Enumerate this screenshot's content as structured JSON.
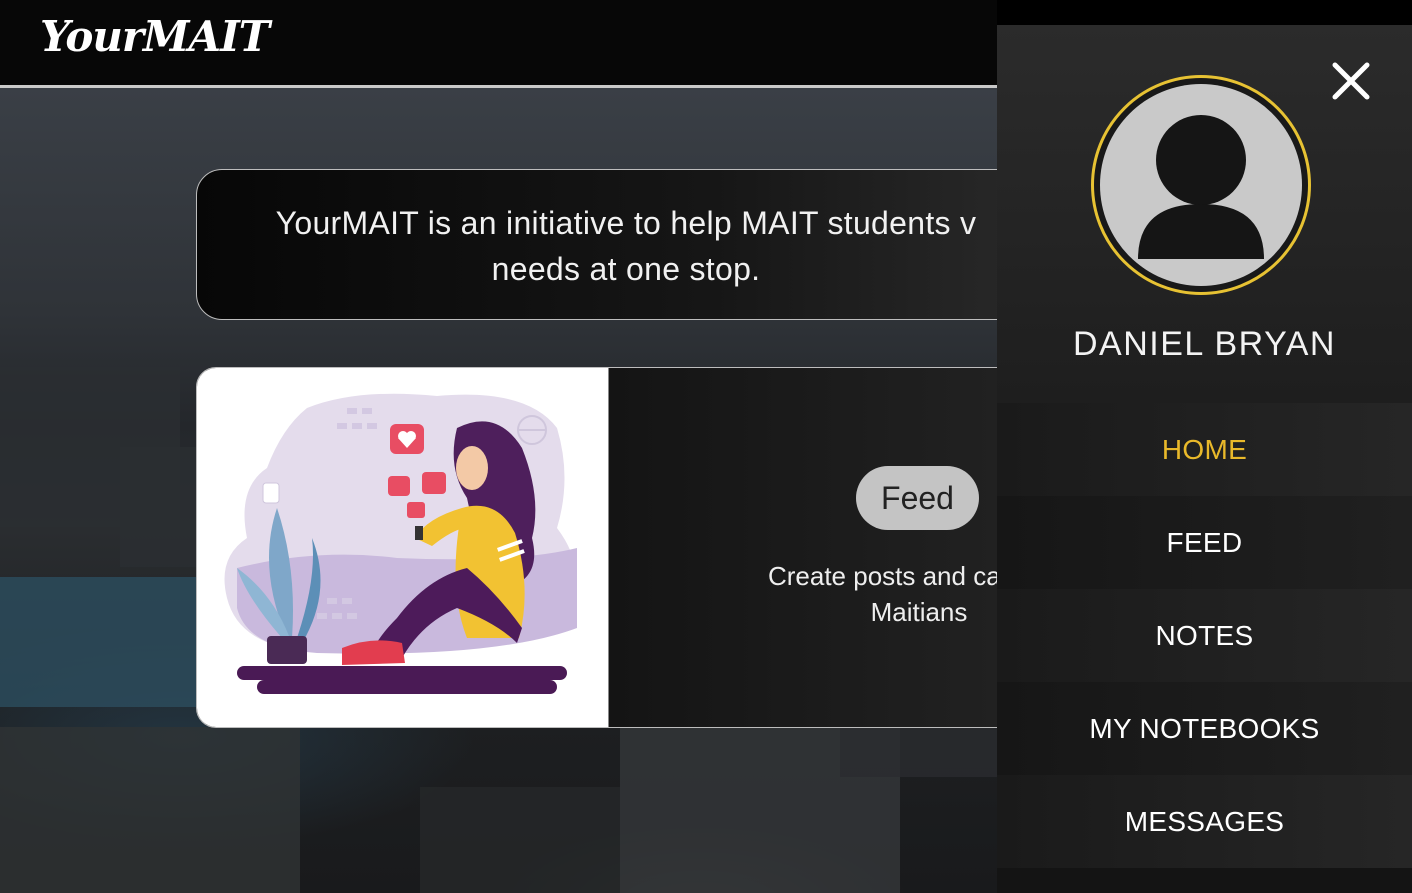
{
  "app": {
    "logo": "YourMAIT"
  },
  "intro": {
    "text_line1": "YourMAIT is an initiative to help MAIT students v",
    "text_line2": "needs at one stop."
  },
  "feature_card": {
    "button_label": "Feed",
    "description_line1": "Create posts and catch lat",
    "description_line2": "Maitians",
    "illustration": "girl-with-phone-illustration"
  },
  "drawer": {
    "user_name": "DANIEL BRYAN",
    "close_icon": "close-icon",
    "avatar_icon": "user-avatar-icon",
    "accent_color": "#e7c233",
    "nav": [
      {
        "label": "HOME",
        "active": true
      },
      {
        "label": "FEED",
        "active": false
      },
      {
        "label": "NOTES",
        "active": false
      },
      {
        "label": "MY NOTEBOOKS",
        "active": false
      },
      {
        "label": "MESSAGES",
        "active": false
      }
    ]
  },
  "colors": {
    "topbar": "#070707",
    "active_nav": "#e9b92a",
    "feed_button": "#c4c4c4"
  }
}
